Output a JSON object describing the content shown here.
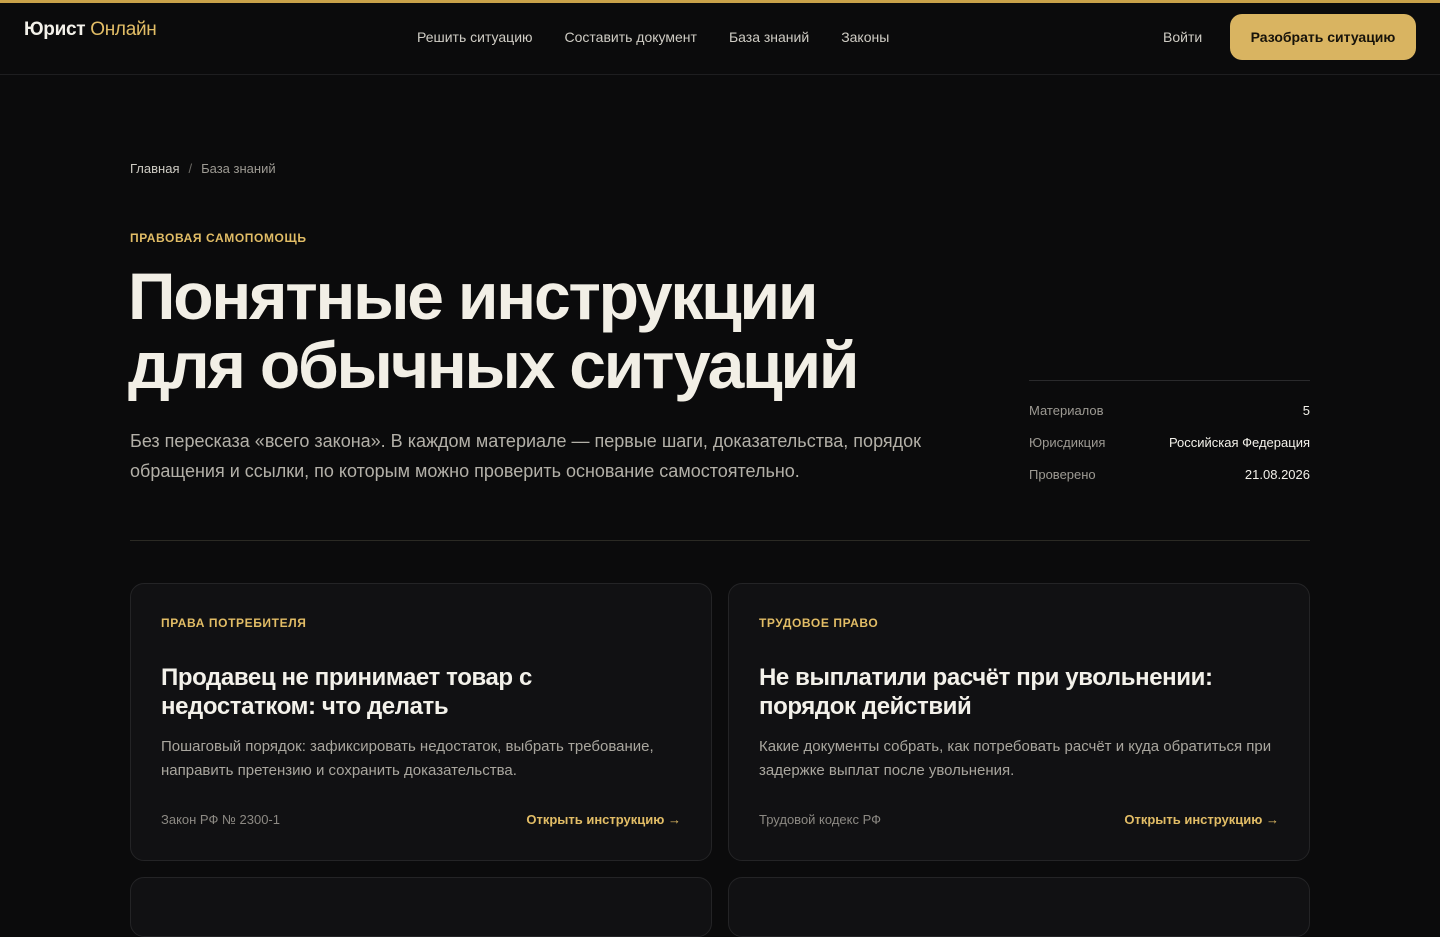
{
  "colors": {
    "accent": "#e2bd66",
    "cta_bg": "#d9b461",
    "background": "#0b0b0c",
    "card_bg": "#111113"
  },
  "header": {
    "logo_main": "Юрист",
    "logo_accent": "Онлайн",
    "nav": [
      "Решить ситуацию",
      "Составить документ",
      "База знаний",
      "Законы"
    ],
    "login": "Войти",
    "cta": "Разобрать ситуацию"
  },
  "breadcrumb": {
    "home": "Главная",
    "separator": "/",
    "current": "База знаний"
  },
  "hero": {
    "eyebrow": "Правовая самопомощь",
    "title_line1": "Понятные инструкции",
    "title_line2": "для обычных ситуаций",
    "lead": "Без пересказа «всего закона». В каждом материале — первые шаги, доказательства, порядок обращения и ссылки, по которым можно проверить основание самостоятельно."
  },
  "meta": [
    {
      "key": "Материалов",
      "value": "5"
    },
    {
      "key": "Юрисдикция",
      "value": "Российская Федерация"
    },
    {
      "key": "Проверено",
      "value": "21.08.2026"
    }
  ],
  "cards": [
    {
      "category": "Права потребителя",
      "title": "Продавец не принимает товар с недостатком: что делать",
      "description": "Пошаговый порядок: зафиксировать недостаток, выбрать требование, направить претензию и сохранить доказательства.",
      "source": "Закон РФ № 2300-1",
      "link": "Открыть инструкцию →"
    },
    {
      "category": "Трудовое право",
      "title": "Не выплатили расчёт при увольнении: порядок действий",
      "description": "Какие документы собрать, как потребовать расчёт и куда обратиться при задержке выплат после увольнения.",
      "source": "Трудовой кодекс РФ",
      "link": "Открыть инструкцию →"
    }
  ]
}
